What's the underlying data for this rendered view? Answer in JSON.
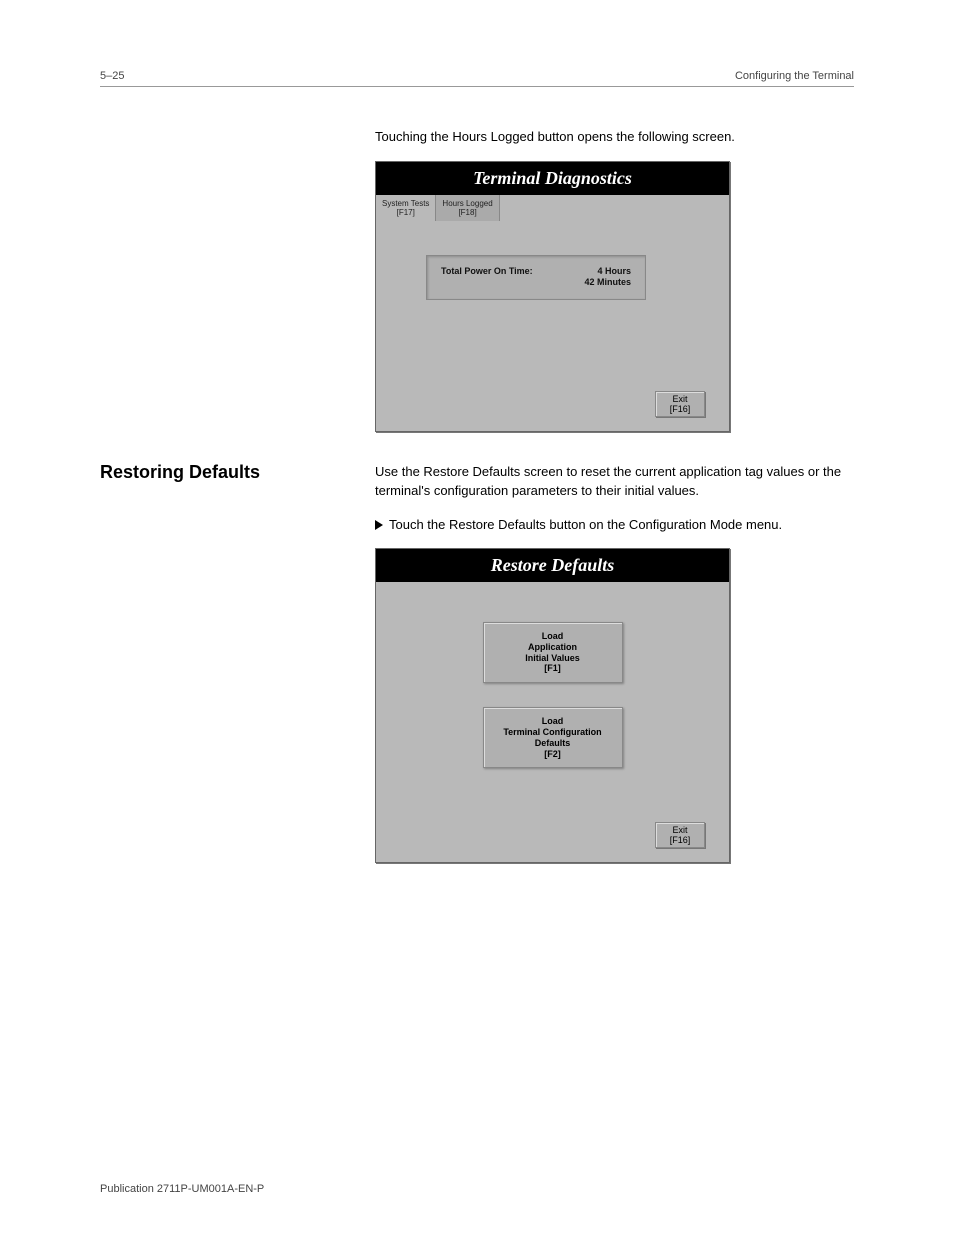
{
  "header": {
    "page_number": "5–25",
    "chapter_title": "Configuring the Terminal"
  },
  "diag": {
    "title": "Terminal Diagnostics",
    "tab1_l1": "System Tests",
    "tab1_l2": "[F17]",
    "tab2_l1": "Hours Logged",
    "tab2_l2": "[F18]",
    "power_label": "Total Power On Time:",
    "hours_val": "4",
    "hours_unit": "Hours",
    "minutes_val": "42",
    "minutes_unit": "Minutes",
    "exit_l1": "Exit",
    "exit_l2": "[F16]",
    "intro": "Touching the Hours Logged button opens the following screen."
  },
  "restore": {
    "heading": "Restoring Defaults",
    "intro": "Use the Restore Defaults screen to reset the current application tag values or the terminal's configuration parameters to their initial values.",
    "open_step": "Touch the Restore Defaults button on the Configuration Mode menu.",
    "app_title": "Restore Defaults",
    "btn1_l1": "Load",
    "btn1_l2": "Application",
    "btn1_l3": "Initial Values",
    "btn1_l4": "[F1]",
    "btn2_l1": "Load",
    "btn2_l2": "Terminal Configuration",
    "btn2_l3": "Defaults",
    "btn2_l4": "[F2]",
    "exit_l1": "Exit",
    "exit_l2": "[F16]"
  },
  "footer": {
    "pub": "Publication 2711P-UM001A-EN-P"
  }
}
